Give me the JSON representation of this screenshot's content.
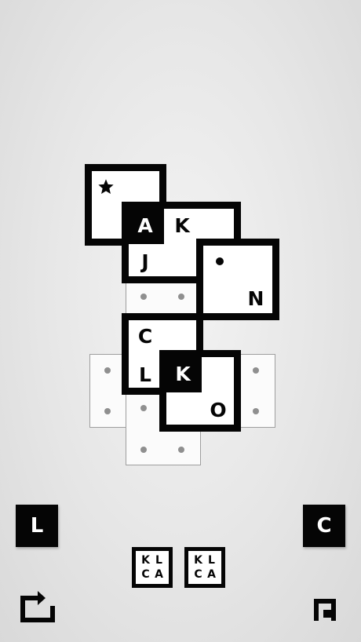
{
  "board": {
    "tiles": [
      {
        "id": "t1",
        "cells": [
          {
            "pos": "tl",
            "star": true
          }
        ]
      },
      {
        "id": "t2",
        "cells": [
          {
            "pos": "tl",
            "text": "A",
            "filled": true
          },
          {
            "pos": "tr",
            "text": "K"
          },
          {
            "pos": "bl",
            "text": "J"
          }
        ]
      },
      {
        "id": "t3",
        "cells": [
          {
            "pos": "tl",
            "dot": true
          },
          {
            "pos": "br",
            "text": "N"
          }
        ]
      },
      {
        "id": "t4",
        "cells": [
          {
            "pos": "tl",
            "text": "C"
          },
          {
            "pos": "bl",
            "text": "L"
          }
        ]
      },
      {
        "id": "t5",
        "cells": [
          {
            "pos": "tl",
            "text": "K",
            "filled": true
          },
          {
            "pos": "br",
            "text": "O"
          }
        ]
      }
    ]
  },
  "controls": {
    "left_button": "L",
    "right_button": "C",
    "undo_icon": "undo-arrow-icon",
    "menu_icon": "corner-menu-icon"
  },
  "goals": [
    {
      "letters": [
        "K",
        "L",
        "C",
        "A"
      ]
    },
    {
      "letters": [
        "K",
        "L",
        "C",
        "A"
      ]
    }
  ]
}
